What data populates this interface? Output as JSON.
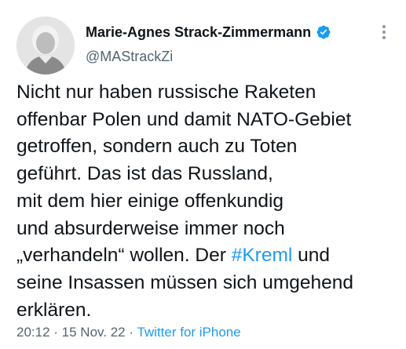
{
  "author": {
    "display_name": "Marie-Agnes Strack-Zimmermann",
    "handle": "@MAStrackZi",
    "verified_icon": "verified-badge-icon",
    "avatar_icon": "avatar-photo",
    "more_icon": "more-options-icon"
  },
  "tweet": {
    "lines": [
      "Nicht nur haben russische Raketen",
      "offenbar Polen und damit NATO-Gebiet",
      "getroffen, sondern auch zu Toten",
      "geführt. Das ist das Russland,",
      "mit dem hier einige offenkundig",
      "und absurderweise immer noch",
      "„verhandeln“ wollen. Der ",
      "#Kreml",
      " und",
      "seine Insassen müssen sich umgehend",
      "erklären."
    ]
  },
  "meta": {
    "time": "20:12",
    "separator": " · ",
    "date": "15 Nov. 22",
    "source": "Twitter for iPhone"
  },
  "colors": {
    "link": "#1d9bf0",
    "secondary_text": "#536471",
    "primary_text": "#0f1419"
  }
}
